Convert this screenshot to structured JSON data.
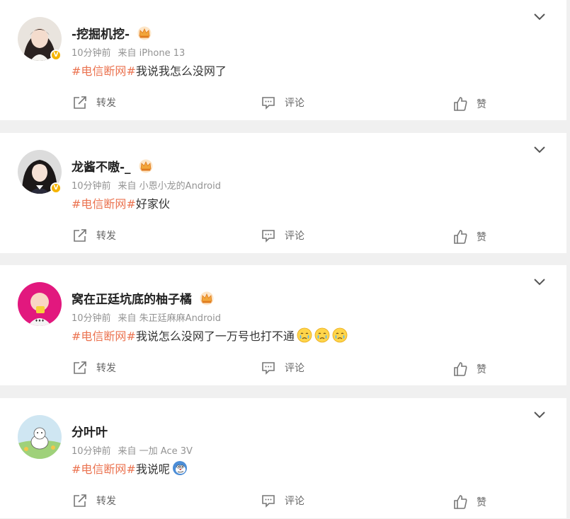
{
  "icons": {
    "share": "share-icon",
    "comment": "comment-icon",
    "like": "thumbs-up-icon",
    "expand": "chevron-down-icon",
    "vip": "crown-icon",
    "verified": "verified-badge-icon"
  },
  "colors": {
    "topic": "#eb7350",
    "verified": "#f5b400",
    "card": "#ffffff",
    "page": "#f0f0f0"
  },
  "posts": [
    {
      "author": "-挖掘机挖-",
      "has_crown": true,
      "time": "10分钟前",
      "source": "来自 iPhone 13",
      "topic": "#电信断网#",
      "text": "我说我怎么没网了",
      "emojis": [],
      "actions": {
        "share": "转发",
        "comment": "评论",
        "like": "赞"
      }
    },
    {
      "author": "龙酱不嗷-_",
      "has_crown": true,
      "time": "10分钟前",
      "source": "来自 小恩小龙的Android",
      "topic": "#电信断网#",
      "text": "好家伙",
      "emojis": [],
      "actions": {
        "share": "转发",
        "comment": "评论",
        "like": "赞"
      }
    },
    {
      "author": "窝在正廷坑底的柚子橘",
      "has_crown": true,
      "time": "10分钟前",
      "source": "来自 朱正廷麻麻Android",
      "topic": "#电信断网#",
      "text": "我说怎么没网了一万号也打不通",
      "emojis": [
        "crying-face-emoji",
        "crying-face-emoji",
        "crying-face-emoji"
      ],
      "actions": {
        "share": "转发",
        "comment": "评论",
        "like": "赞"
      }
    },
    {
      "author": "分叶叶",
      "has_crown": false,
      "time": "10分钟前",
      "source": "来自 一加 Ace 3V",
      "topic": "#电信断网#",
      "text": "我说呢",
      "emojis": [
        "doge-emoji"
      ],
      "actions": {
        "share": "转发",
        "comment": "评论",
        "like": "赞"
      }
    }
  ]
}
